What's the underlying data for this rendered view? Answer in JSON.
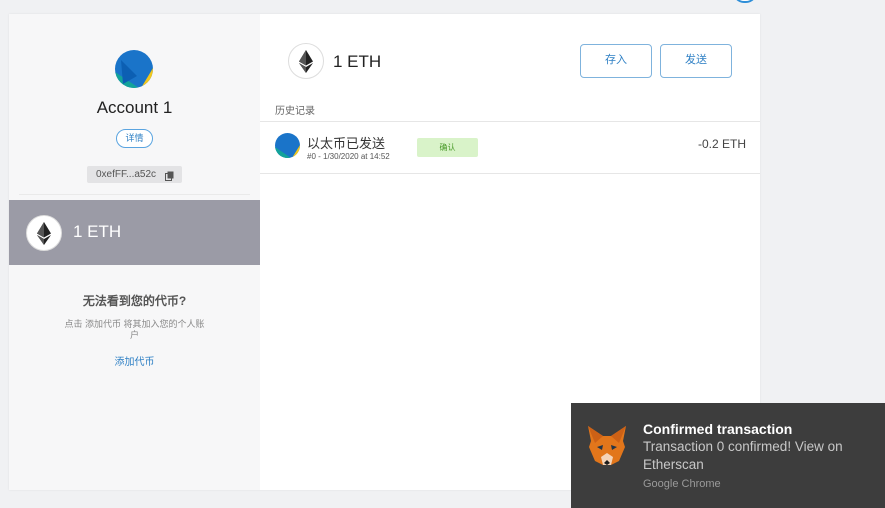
{
  "sidebar": {
    "account_name": "Account 1",
    "details_label": "详情",
    "address": "0xefFF...a52c",
    "balance": "1 ETH",
    "cant_see_title": "无法看到您的代币?",
    "cant_see_desc": "点击 添加代币 将其加入您的个人账户",
    "add_token_label": "添加代币"
  },
  "main": {
    "balance": "1 ETH",
    "deposit_label": "存入",
    "send_label": "发送",
    "history_label": "历史记录",
    "transactions": [
      {
        "title": "以太币已发送",
        "subtitle": "#0 - 1/30/2020 at 14:52",
        "status": "确认",
        "amount": "-0.2 ETH"
      }
    ]
  },
  "toast": {
    "title": "Confirmed transaction",
    "body": "Transaction 0 confirmed! View on Etherscan",
    "app": "Google Chrome"
  },
  "icons": {
    "account_avatar": "jazzicon-avatar",
    "eth": "ethereum-icon",
    "copy": "copy-icon",
    "toast_logo": "metamask-fox-icon"
  },
  "colors": {
    "accent": "#2f80c5",
    "balance_bg": "#9b9ba6",
    "status_bg": "#d9f3c9",
    "toast_bg": "#3d3d3d"
  }
}
